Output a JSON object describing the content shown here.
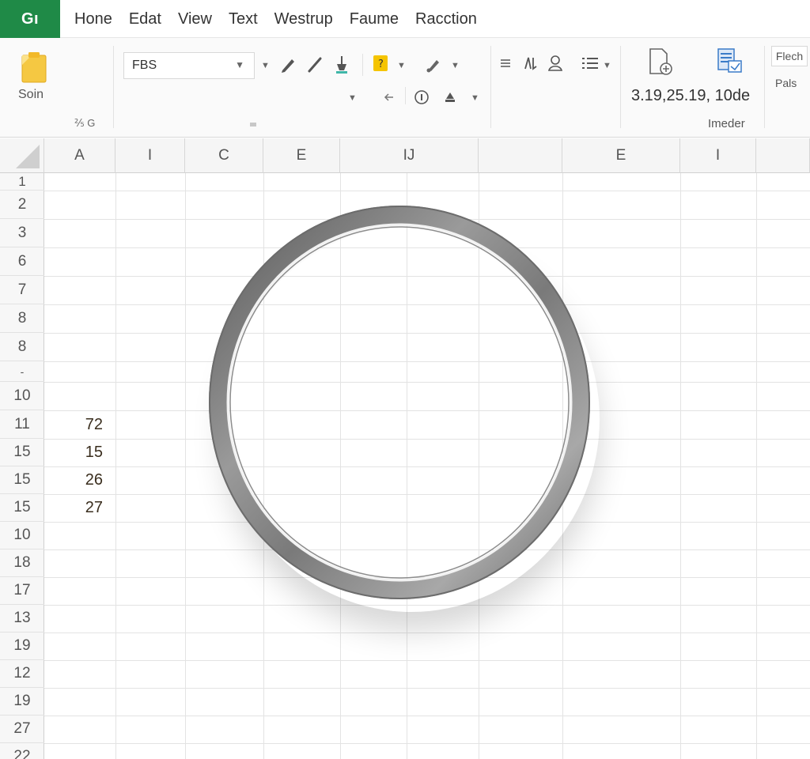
{
  "app": {
    "badge": "Gı"
  },
  "menu": [
    "Hone",
    "Edat",
    "View",
    "Text",
    "Westrup",
    "Faume",
    "Racction"
  ],
  "ribbon": {
    "paste_label": "Soin",
    "clipboard_caption": "⅖ G",
    "font_name": "FBS",
    "reference_text": "3.19,25.19, 10de",
    "insert_caption": "Imeder",
    "fetch_label": "Flech",
    "pals_label": "Pals"
  },
  "grid": {
    "columns": [
      "A",
      "I",
      "C",
      "E",
      "IJ",
      "",
      "E",
      "I",
      ""
    ],
    "rows": [
      "1",
      "2",
      "3",
      "6",
      "7",
      "8",
      "8",
      "-",
      "10",
      "11",
      "15",
      "15",
      "15",
      "10",
      "18",
      "17",
      "13",
      "19",
      "12",
      "19",
      "27",
      "22"
    ],
    "column_a_values": [
      "72",
      "15",
      "26",
      "27"
    ]
  },
  "colors": {
    "brand": "#1f8a47",
    "paste_icon": "#f5c842",
    "accent_blue": "#3a7bc8",
    "ring": "#8a8a8a"
  },
  "icons": {
    "ribbon": [
      "paste-clipboard-icon",
      "pencil-icon",
      "line-icon",
      "paint-bucket-icon",
      "highlight-icon",
      "brush-icon",
      "align-icon",
      "text-direction-icon",
      "person-icon",
      "list-icon",
      "new-document-icon",
      "table-insert-icon",
      "info-icon",
      "fill-icon",
      "undo-arrow-icon"
    ]
  }
}
